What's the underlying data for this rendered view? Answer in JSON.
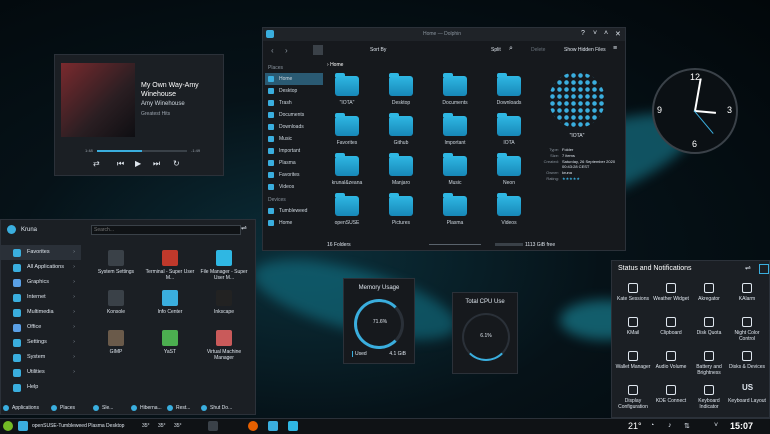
{
  "player": {
    "title": "My Own Way-Amy Winehouse",
    "artist": "Amy Winehouse",
    "album": "Greatest Hits",
    "elapsed": "1:48",
    "remaining": "-1:49",
    "progress": 0.5
  },
  "dolphin": {
    "window_title": "Home — Dolphin",
    "breadcrumb": "Home",
    "sort": "Sort By",
    "split": "Split",
    "delete": "Delete",
    "hidden": "Show Hidden Files",
    "places_header": "Places",
    "devices_header": "Devices",
    "places": [
      "Home",
      "Desktop",
      "Trash",
      "Documents",
      "Downloads",
      "Music",
      "Important",
      "Plasma",
      "Favorites",
      "Videos"
    ],
    "devices": [
      "Tumbleweed",
      "Home"
    ],
    "files": [
      "\"IOTA\"",
      "Desktop",
      "Documents",
      "Downloads",
      "Favorites",
      "Github",
      "Important",
      "IOTA",
      "krunal&zeana",
      "Manjaro",
      "Music",
      "Neon",
      "openSUSE",
      "Pictures",
      "Plasma",
      "Videos"
    ],
    "status_left": "16 Folders",
    "status_right": "1113 GiB free",
    "info": {
      "name": "\"IOTA\"",
      "rows": [
        [
          "Type:",
          "Folder"
        ],
        [
          "Size:",
          "7 items"
        ],
        [
          "Created:",
          "Saturday, 26 September 2020 00:43:28 CEST"
        ],
        [
          "Owner:",
          "kruna"
        ],
        [
          "Rating:",
          "★★★★★"
        ]
      ]
    }
  },
  "launcher": {
    "user": "Kruna",
    "search_placeholder": "Search...",
    "categories": [
      "Favorites",
      "All Applications",
      "Graphics",
      "Internet",
      "Multimedia",
      "Office",
      "Settings",
      "System",
      "Utilities",
      "Help"
    ],
    "apps": [
      "System Settings",
      "Terminal - Super User M...",
      "File Manager - Super User M...",
      "Konsole",
      "Info Center",
      "Inkscape",
      "GIMP",
      "YaST",
      "Virtual Machine Manager"
    ],
    "footer": [
      "Applications",
      "Places",
      "Sle...",
      "Hiberna...",
      "Rest...",
      "Shut Do..."
    ]
  },
  "memory": {
    "title": "Memory Usage",
    "percent": "71.6%",
    "used_label": "Used",
    "used_value": "4.1 GiB"
  },
  "cpu": {
    "title": "Total CPU Use",
    "percent": "6.1%"
  },
  "notifications": {
    "title": "Status and Notifications",
    "items": [
      "Kate Sessions",
      "Weather Widget",
      "Akregator",
      "KAlarm",
      "KMail",
      "Clipboard",
      "Disk Quota",
      "Night Color Control",
      "Wallet Manager",
      "Audio Volume",
      "Battery and Brightness",
      "Disks & Devices",
      "Display Configuration",
      "KDE Connect",
      "Keyboard Indicator",
      "Keyboard Layout"
    ],
    "layout_code": "US"
  },
  "taskbar": {
    "task1": "openSUSE-Tumbleweed",
    "task2": "Plasma Desktop",
    "temps": [
      "35°",
      "35°",
      "35°"
    ],
    "weather": "21°",
    "clock": "15:07"
  },
  "colors": {
    "accent": "#3aaede",
    "panel": "#1b1f24",
    "folder": "#2fb7e3"
  }
}
